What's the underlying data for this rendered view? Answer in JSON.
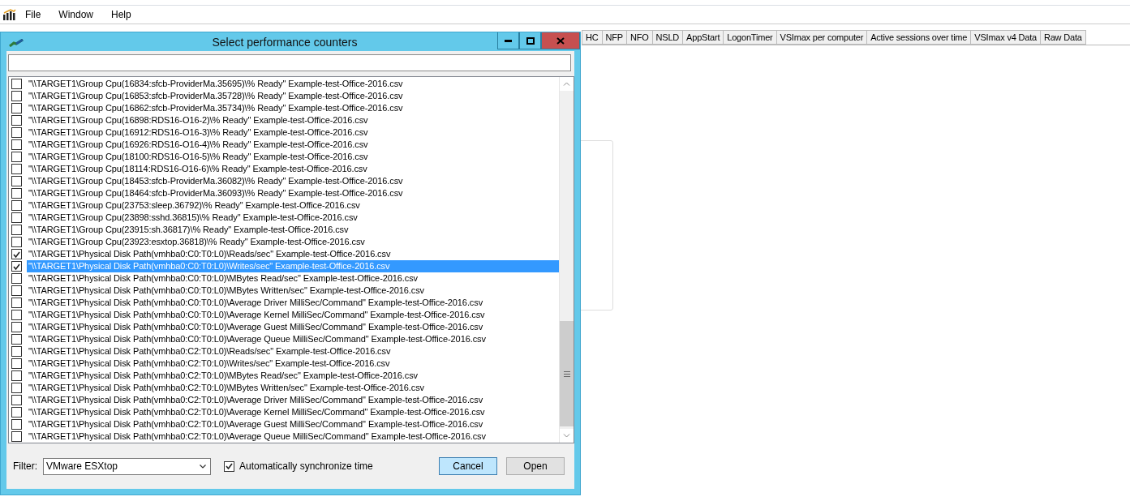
{
  "menu": [
    "File",
    "Window",
    "Help"
  ],
  "tabs": [
    {
      "label": "HC"
    },
    {
      "label": "NFP"
    },
    {
      "label": "NFO"
    },
    {
      "label": "NSLD"
    },
    {
      "label": "AppStart"
    },
    {
      "label": "LogonTimer"
    },
    {
      "label": "VSImax per computer"
    },
    {
      "label": "Active sessions over time"
    },
    {
      "label": "VSImax v4 Data"
    },
    {
      "label": "Raw Data"
    }
  ],
  "dialog": {
    "title": "Select performance counters",
    "counters": [
      {
        "text": "\"\\\\TARGET1\\Group Cpu(16834:sfcb-ProviderMa.35695)\\% Ready\" Example-test-Office-2016.csv",
        "checked": false,
        "selected": false
      },
      {
        "text": "\"\\\\TARGET1\\Group Cpu(16853:sfcb-ProviderMa.35728)\\% Ready\" Example-test-Office-2016.csv",
        "checked": false,
        "selected": false
      },
      {
        "text": "\"\\\\TARGET1\\Group Cpu(16862:sfcb-ProviderMa.35734)\\% Ready\" Example-test-Office-2016.csv",
        "checked": false,
        "selected": false
      },
      {
        "text": "\"\\\\TARGET1\\Group Cpu(16898:RDS16-O16-2)\\% Ready\" Example-test-Office-2016.csv",
        "checked": false,
        "selected": false
      },
      {
        "text": "\"\\\\TARGET1\\Group Cpu(16912:RDS16-O16-3)\\% Ready\" Example-test-Office-2016.csv",
        "checked": false,
        "selected": false
      },
      {
        "text": "\"\\\\TARGET1\\Group Cpu(16926:RDS16-O16-4)\\% Ready\" Example-test-Office-2016.csv",
        "checked": false,
        "selected": false
      },
      {
        "text": "\"\\\\TARGET1\\Group Cpu(18100:RDS16-O16-5)\\% Ready\" Example-test-Office-2016.csv",
        "checked": false,
        "selected": false
      },
      {
        "text": "\"\\\\TARGET1\\Group Cpu(18114:RDS16-O16-6)\\% Ready\" Example-test-Office-2016.csv",
        "checked": false,
        "selected": false
      },
      {
        "text": "\"\\\\TARGET1\\Group Cpu(18453:sfcb-ProviderMa.36082)\\% Ready\" Example-test-Office-2016.csv",
        "checked": false,
        "selected": false
      },
      {
        "text": "\"\\\\TARGET1\\Group Cpu(18464:sfcb-ProviderMa.36093)\\% Ready\" Example-test-Office-2016.csv",
        "checked": false,
        "selected": false
      },
      {
        "text": "\"\\\\TARGET1\\Group Cpu(23753:sleep.36792)\\% Ready\" Example-test-Office-2016.csv",
        "checked": false,
        "selected": false
      },
      {
        "text": "\"\\\\TARGET1\\Group Cpu(23898:sshd.36815)\\% Ready\" Example-test-Office-2016.csv",
        "checked": false,
        "selected": false
      },
      {
        "text": "\"\\\\TARGET1\\Group Cpu(23915:sh.36817)\\% Ready\" Example-test-Office-2016.csv",
        "checked": false,
        "selected": false
      },
      {
        "text": "\"\\\\TARGET1\\Group Cpu(23923:esxtop.36818)\\% Ready\" Example-test-Office-2016.csv",
        "checked": false,
        "selected": false
      },
      {
        "text": "\"\\\\TARGET1\\Physical Disk Path(vmhba0:C0:T0:L0)\\Reads/sec\" Example-test-Office-2016.csv",
        "checked": true,
        "selected": false
      },
      {
        "text": "\"\\\\TARGET1\\Physical Disk Path(vmhba0:C0:T0:L0)\\Writes/sec\" Example-test-Office-2016.csv",
        "checked": true,
        "selected": true
      },
      {
        "text": "\"\\\\TARGET1\\Physical Disk Path(vmhba0:C0:T0:L0)\\MBytes Read/sec\" Example-test-Office-2016.csv",
        "checked": false,
        "selected": false
      },
      {
        "text": "\"\\\\TARGET1\\Physical Disk Path(vmhba0:C0:T0:L0)\\MBytes Written/sec\" Example-test-Office-2016.csv",
        "checked": false,
        "selected": false
      },
      {
        "text": "\"\\\\TARGET1\\Physical Disk Path(vmhba0:C0:T0:L0)\\Average Driver MilliSec/Command\" Example-test-Office-2016.csv",
        "checked": false,
        "selected": false
      },
      {
        "text": "\"\\\\TARGET1\\Physical Disk Path(vmhba0:C0:T0:L0)\\Average Kernel MilliSec/Command\" Example-test-Office-2016.csv",
        "checked": false,
        "selected": false
      },
      {
        "text": "\"\\\\TARGET1\\Physical Disk Path(vmhba0:C0:T0:L0)\\Average Guest MilliSec/Command\" Example-test-Office-2016.csv",
        "checked": false,
        "selected": false
      },
      {
        "text": "\"\\\\TARGET1\\Physical Disk Path(vmhba0:C0:T0:L0)\\Average Queue MilliSec/Command\" Example-test-Office-2016.csv",
        "checked": false,
        "selected": false
      },
      {
        "text": "\"\\\\TARGET1\\Physical Disk Path(vmhba0:C2:T0:L0)\\Reads/sec\" Example-test-Office-2016.csv",
        "checked": false,
        "selected": false
      },
      {
        "text": "\"\\\\TARGET1\\Physical Disk Path(vmhba0:C2:T0:L0)\\Writes/sec\" Example-test-Office-2016.csv",
        "checked": false,
        "selected": false
      },
      {
        "text": "\"\\\\TARGET1\\Physical Disk Path(vmhba0:C2:T0:L0)\\MBytes Read/sec\" Example-test-Office-2016.csv",
        "checked": false,
        "selected": false
      },
      {
        "text": "\"\\\\TARGET1\\Physical Disk Path(vmhba0:C2:T0:L0)\\MBytes Written/sec\" Example-test-Office-2016.csv",
        "checked": false,
        "selected": false
      },
      {
        "text": "\"\\\\TARGET1\\Physical Disk Path(vmhba0:C2:T0:L0)\\Average Driver MilliSec/Command\" Example-test-Office-2016.csv",
        "checked": false,
        "selected": false
      },
      {
        "text": "\"\\\\TARGET1\\Physical Disk Path(vmhba0:C2:T0:L0)\\Average Kernel MilliSec/Command\" Example-test-Office-2016.csv",
        "checked": false,
        "selected": false
      },
      {
        "text": "\"\\\\TARGET1\\Physical Disk Path(vmhba0:C2:T0:L0)\\Average Guest MilliSec/Command\" Example-test-Office-2016.csv",
        "checked": false,
        "selected": false
      },
      {
        "text": "\"\\\\TARGET1\\Physical Disk Path(vmhba0:C2:T0:L0)\\Average Queue MilliSec/Command\" Example-test-Office-2016.csv",
        "checked": false,
        "selected": false
      }
    ],
    "filter": {
      "label": "Filter:",
      "value": "VMware ESXtop"
    },
    "sync": {
      "label": "Automatically synchronize time",
      "checked": true
    },
    "buttons": [
      {
        "label": "Cancel",
        "focused": true
      },
      {
        "label": "Open",
        "focused": false
      }
    ]
  }
}
